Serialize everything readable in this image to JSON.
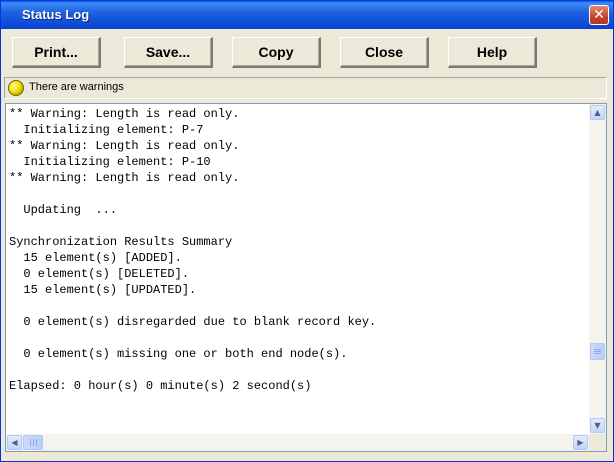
{
  "window": {
    "title": "Status Log",
    "close_glyph": "✕"
  },
  "toolbar": {
    "buttons": [
      {
        "label": "Print...",
        "accel": "P"
      },
      {
        "label": "Save...",
        "accel": "S"
      },
      {
        "label": "Copy",
        "accel": "C"
      },
      {
        "label": "Close",
        "accel": "C"
      },
      {
        "label": "Help",
        "accel": "H"
      }
    ]
  },
  "status": {
    "icon": "warning-bulb-icon",
    "text": "There are warnings",
    "color": "#f0e000"
  },
  "log": {
    "lines": [
      "** Warning: Length is read only.",
      "  Initializing element: P-7",
      "** Warning: Length is read only.",
      "  Initializing element: P-10",
      "** Warning: Length is read only.",
      "",
      "  Updating  ...",
      "",
      "Synchronization Results Summary",
      "  15 element(s) [ADDED].",
      "  0 element(s) [DELETED].",
      "  15 element(s) [UPDATED].",
      "",
      "  0 element(s) disregarded due to blank record key.",
      "",
      "  0 element(s) missing one or both end node(s).",
      "",
      "Elapsed: 0 hour(s) 0 minute(s) 2 second(s)"
    ]
  },
  "scrollbars": {
    "up_glyph": "▲",
    "down_glyph": "▼",
    "left_glyph": "◀",
    "right_glyph": "▶"
  }
}
